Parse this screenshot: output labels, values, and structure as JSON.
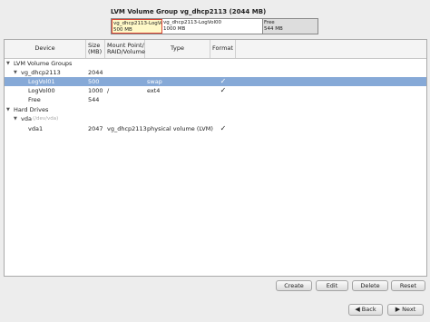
{
  "lvm_summary": {
    "title": "LVM Volume Group vg_dhcp2113 (2044 MB)",
    "segments": [
      {
        "name": "vg_dhcp2113-LogVol01",
        "size": "500 MB"
      },
      {
        "name": "vg_dhcp2113-LogVol00",
        "size": "1000 MB"
      },
      {
        "name": "Free",
        "size": "544 MB"
      }
    ]
  },
  "columns": {
    "device": "Device",
    "size": "Size\n(MB)",
    "mount": "Mount Point/\nRAID/Volume",
    "type": "Type",
    "format": "Format"
  },
  "rows": [
    {
      "device": "LVM Volume Groups",
      "size": "",
      "mount": "",
      "type": "",
      "format": ""
    },
    {
      "device": "vg_dhcp2113",
      "size": "2044",
      "mount": "",
      "type": "",
      "format": ""
    },
    {
      "device": "LogVol01",
      "size": "500",
      "mount": "",
      "type": "swap",
      "format": "✓"
    },
    {
      "device": "LogVol00",
      "size": "1000",
      "mount": "/",
      "type": "ext4",
      "format": "✓"
    },
    {
      "device": "Free",
      "size": "544",
      "mount": "",
      "type": "",
      "format": ""
    },
    {
      "device": "Hard Drives",
      "size": "",
      "mount": "",
      "type": "",
      "format": ""
    },
    {
      "device": "vda",
      "device_note": "(/dev/vda)",
      "size": "",
      "mount": "",
      "type": "",
      "format": ""
    },
    {
      "device": "vda1",
      "size": "2047",
      "mount": "vg_dhcp2113",
      "type": "physical volume (LVM)",
      "format": "✓"
    }
  ],
  "buttons": {
    "create": "Create",
    "edit": "Edit",
    "delete": "Delete",
    "reset": "Reset",
    "back": "Back",
    "next": "Next"
  },
  "colors": {
    "selection": "#86a9d7",
    "swap_segment_border": "#dd4433",
    "swap_segment_fill": "#fff9c8",
    "free_segment_fill": "#dddddd"
  }
}
